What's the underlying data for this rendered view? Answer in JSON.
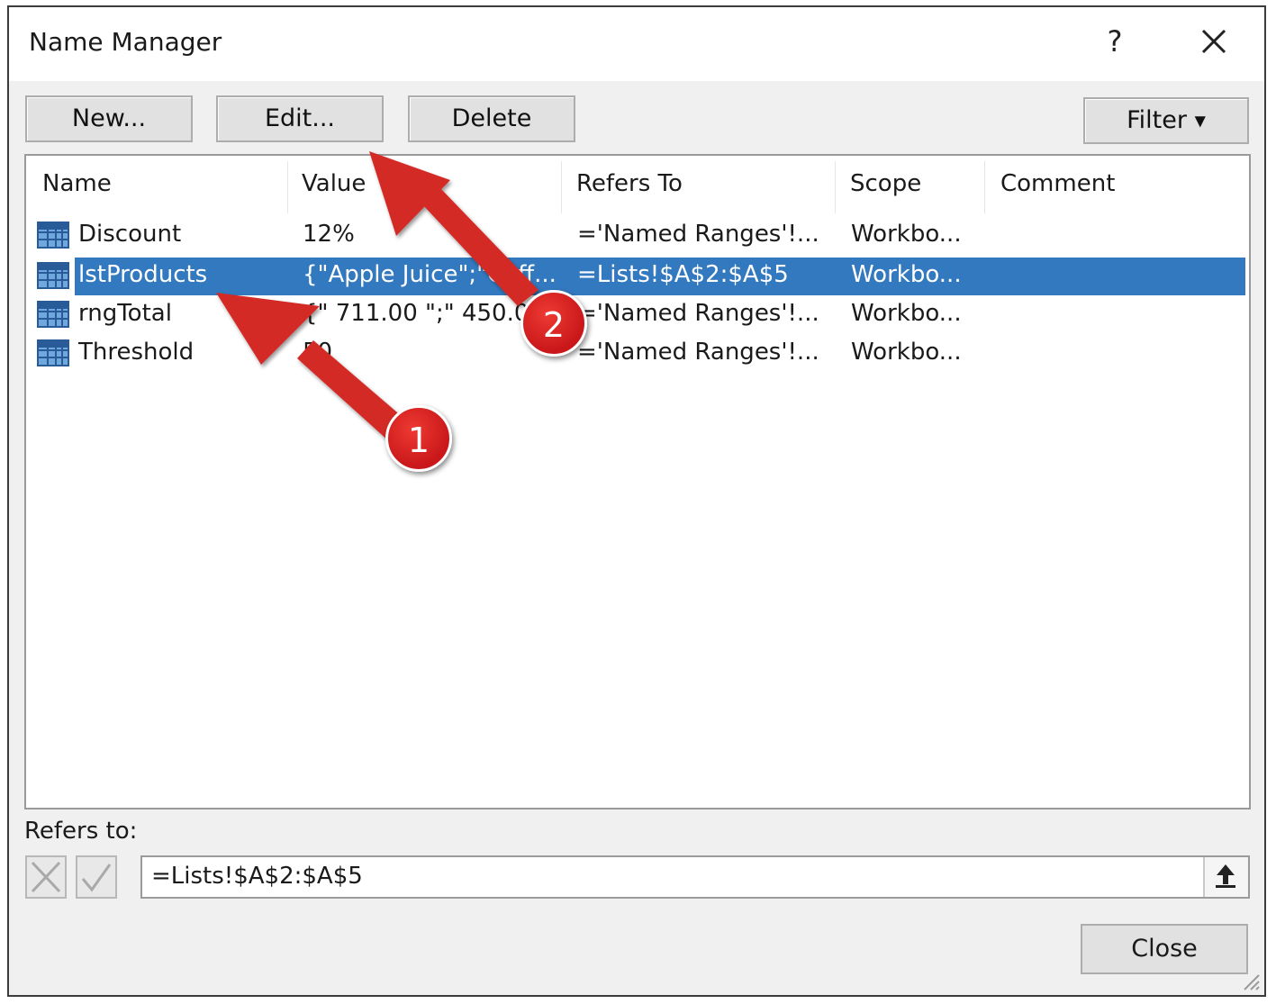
{
  "window": {
    "title": "Name Manager",
    "help_label": "?",
    "close_icon": "close-icon"
  },
  "toolbar": {
    "new_label": "New...",
    "edit_label": "Edit...",
    "delete_label": "Delete",
    "filter_label": "Filter"
  },
  "columns": [
    "Name",
    "Value",
    "Refers To",
    "Scope",
    "Comment"
  ],
  "rows": [
    {
      "name": "Discount",
      "value": "12%",
      "refers_to": "='Named Ranges'!...",
      "scope": "Workbo...",
      "comment": "",
      "selected": false
    },
    {
      "name": "lstProducts",
      "value": "{\"Apple Juice\";\"Coff...",
      "refers_to": "=Lists!$A$2:$A$5",
      "scope": "Workbo...",
      "comment": "",
      "selected": true
    },
    {
      "name": "rngTotal",
      "value": "{\" 711.00 \";\" 450.00",
      "refers_to": "='Named Ranges'!...",
      "scope": "Workbo...",
      "comment": "",
      "selected": false
    },
    {
      "name": "Threshold",
      "value": "50",
      "refers_to": "='Named Ranges'!...",
      "scope": "Workbo...",
      "comment": "",
      "selected": false
    }
  ],
  "refers_to": {
    "label": "Refers to:",
    "value": "=Lists!$A$2:$A$5"
  },
  "footer": {
    "close_label": "Close"
  },
  "annotations": {
    "badge_1": "1",
    "badge_2": "2"
  },
  "colors": {
    "selection": "#3379bf",
    "annotation_red": "#d42a27",
    "dialog_bg": "#f0f0f0"
  }
}
